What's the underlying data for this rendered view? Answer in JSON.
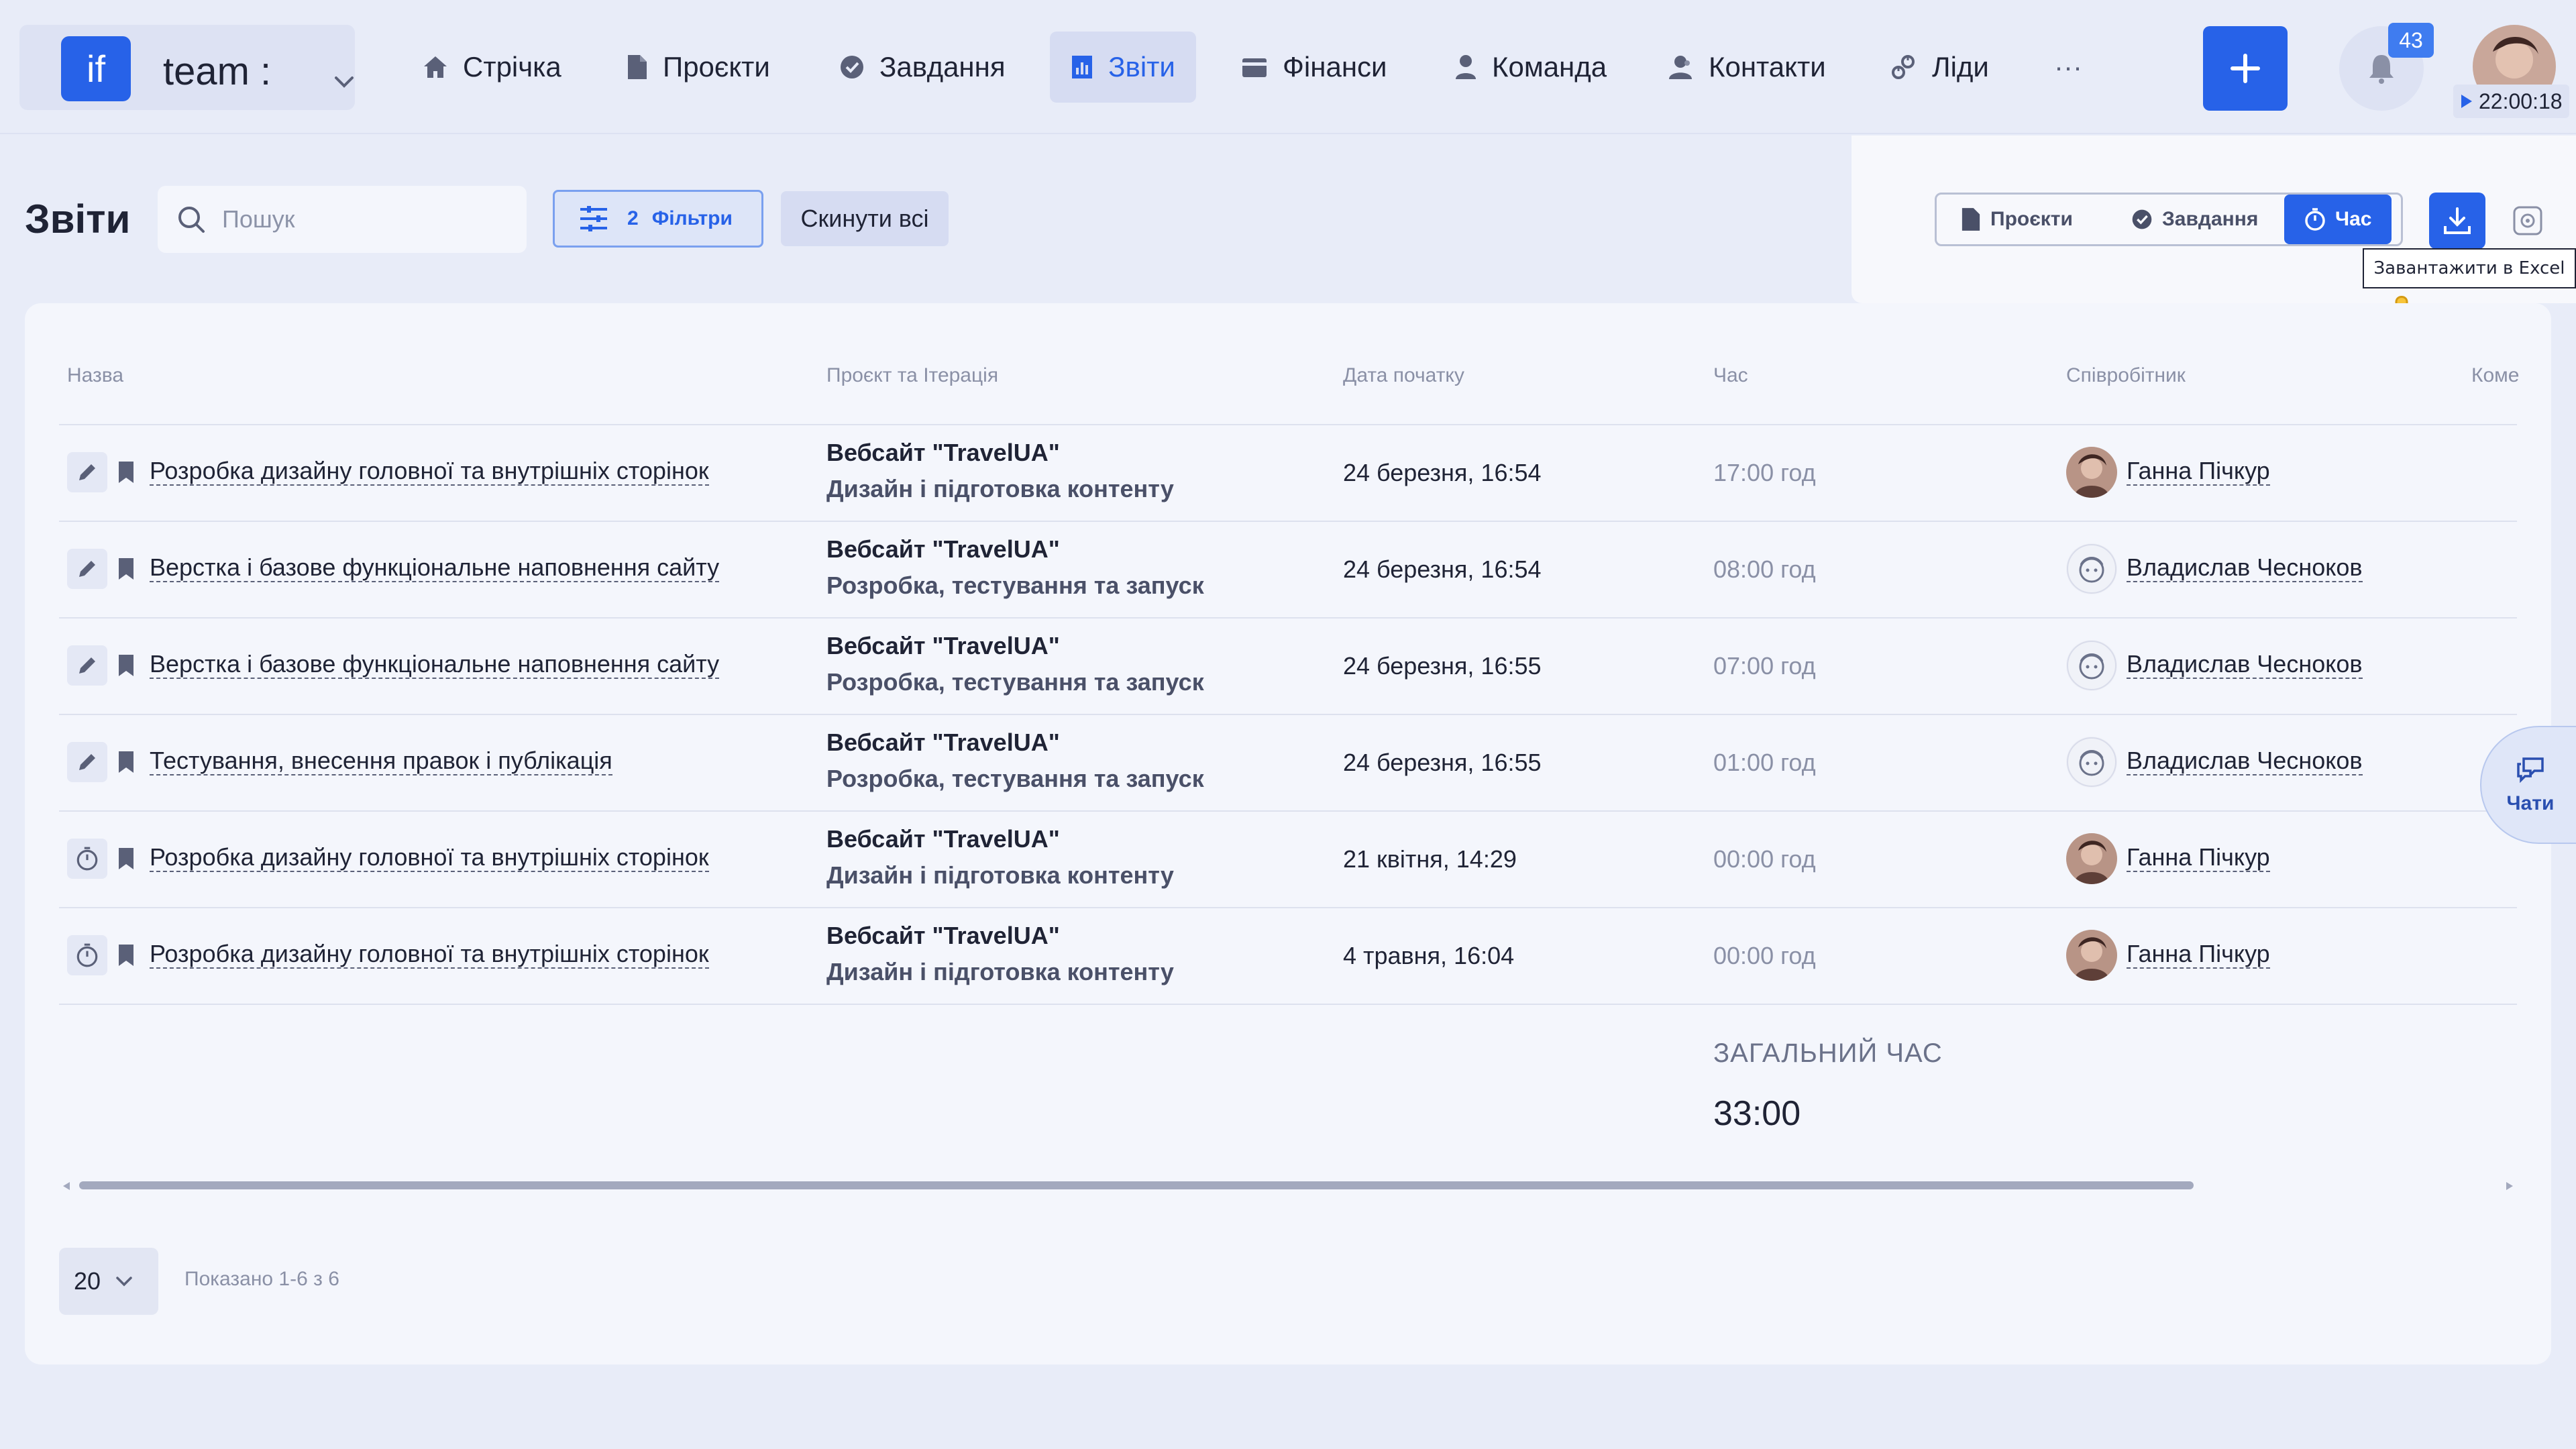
{
  "app": {
    "logo_text": "if",
    "workspace_name": "team :"
  },
  "nav": {
    "items": [
      {
        "label": "Стрічка",
        "icon": "home-icon"
      },
      {
        "label": "Проєкти",
        "icon": "file-icon"
      },
      {
        "label": "Завдання",
        "icon": "check-circle-icon"
      },
      {
        "label": "Звіти",
        "icon": "chart-icon",
        "active": true
      },
      {
        "label": "Фінанси",
        "icon": "wallet-icon"
      },
      {
        "label": "Команда",
        "icon": "user-icon"
      },
      {
        "label": "Контакти",
        "icon": "contacts-icon"
      },
      {
        "label": "Ліди",
        "icon": "leads-icon"
      }
    ],
    "more_label": "···",
    "notifications_count": "43",
    "timer": "22:00:18"
  },
  "page": {
    "title": "Звіти",
    "search_placeholder": "Пошук",
    "filters_count": "2",
    "filters_label": "Фільтри",
    "reset_label": "Скинути всі"
  },
  "view_toggle": {
    "options": [
      "Проєкти",
      "Завдання",
      "Час"
    ],
    "active": "Час"
  },
  "tooltip": {
    "download": "Завантажити в Excel"
  },
  "table": {
    "columns": [
      "Назва",
      "Проєкт та Ітерація",
      "Дата початку",
      "Час",
      "Співробітник",
      "Коме"
    ],
    "rows": [
      {
        "type": "edit",
        "task": "Розробка дизайну головної та внутрішніх сторінок",
        "project": "Вебсайт \"TravelUA\"",
        "iteration": "Дизайн і підготовка контенту",
        "date": "24 березня, 16:54",
        "hours": "17:00 год",
        "employee": "Ганна Пічкур",
        "avatar": "photo"
      },
      {
        "type": "edit",
        "task": "Верстка і базове функціональне наповнення сайту",
        "project": "Вебсайт \"TravelUA\"",
        "iteration": "Розробка, тестування та запуск",
        "date": "24 березня, 16:54",
        "hours": "08:00 год",
        "employee": "Владислав Чесноков",
        "avatar": "default"
      },
      {
        "type": "edit",
        "task": "Верстка і базове функціональне наповнення сайту",
        "project": "Вебсайт \"TravelUA\"",
        "iteration": "Розробка, тестування та запуск",
        "date": "24 березня, 16:55",
        "hours": "07:00 год",
        "employee": "Владислав Чесноков",
        "avatar": "default"
      },
      {
        "type": "edit",
        "task": "Тестування, внесення правок і публікація",
        "project": "Вебсайт \"TravelUA\"",
        "iteration": "Розробка, тестування та запуск",
        "date": "24 березня, 16:55",
        "hours": "01:00 год",
        "employee": "Владислав Чесноков",
        "avatar": "default"
      },
      {
        "type": "timer",
        "task": "Розробка дизайну головної та внутрішніх сторінок",
        "project": "Вебсайт \"TravelUA\"",
        "iteration": "Дизайн і підготовка контенту",
        "date": "21 квітня, 14:29",
        "hours": "00:00 год",
        "employee": "Ганна Пічкур",
        "avatar": "photo"
      },
      {
        "type": "timer",
        "task": "Розробка дизайну головної та внутрішніх сторінок",
        "project": "Вебсайт \"TravelUA\"",
        "iteration": "Дизайн і підготовка контенту",
        "date": "4 травня, 16:04",
        "hours": "00:00 год",
        "employee": "Ганна Пічкур",
        "avatar": "photo"
      }
    ],
    "total_label": "ЗАГАЛЬНИЙ ЧАС",
    "total_value": "33:00"
  },
  "pagination": {
    "per_page": "20",
    "shown": "Показано 1-6 з 6"
  },
  "chats": {
    "label": "Чати"
  },
  "colors": {
    "accent": "#2762e8",
    "background": "#e8ecf8",
    "card": "#f4f6fc"
  }
}
